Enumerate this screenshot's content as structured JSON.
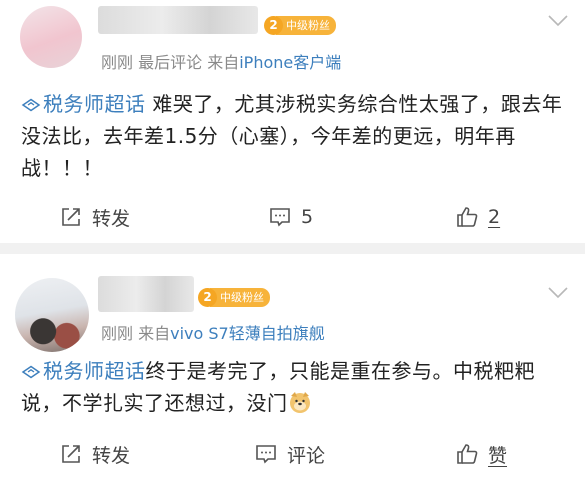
{
  "posts": [
    {
      "badge_level": "2",
      "badge_label": "中级粉丝",
      "meta_time": "刚刚",
      "meta_extra": "最后评论",
      "meta_from": "来自",
      "meta_device": "iPhone客户端",
      "topic": "税务师超话",
      "text": "难哭了，尤其涉税实务综合性太强了，跟去年没法比，去年差1.5分（心塞），今年差的更远，明年再战！！！",
      "share_label": "转发",
      "comment_label": "5",
      "like_label": "2"
    },
    {
      "badge_level": "2",
      "badge_label": "中级粉丝",
      "meta_time": "刚刚",
      "meta_from": "来自",
      "meta_device": "vivo S7轻薄自拍旗舰",
      "topic": "税务师超话",
      "text": "终于是考完了，只能是重在参与。中税粑粑说，不学扎实了还想过，没门",
      "share_label": "转发",
      "comment_label": "评论",
      "like_label": "赞"
    }
  ],
  "colors": {
    "accent": "#3d7fbd",
    "badge": "#f5a623",
    "muted": "#8a8a8a",
    "separator": "#f1f1f1"
  },
  "icons": [
    "chevron-down-icon",
    "topic-diamond-icon",
    "share-icon",
    "comment-icon",
    "like-icon",
    "doge-emoji-icon"
  ]
}
